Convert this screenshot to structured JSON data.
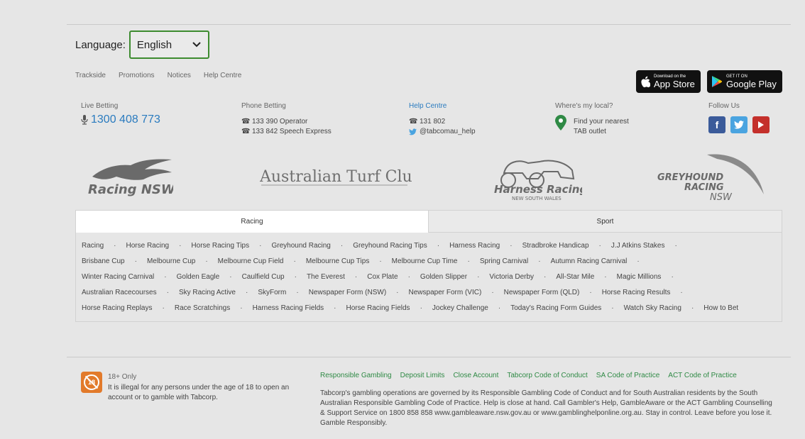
{
  "language": {
    "label": "Language:",
    "selected": "English"
  },
  "quick_links": [
    "Trackside",
    "Promotions",
    "Notices",
    "Help Centre"
  ],
  "app_store": {
    "small": "Download on the",
    "big": "App Store"
  },
  "google_play": {
    "small": "GET IT ON",
    "big": "Google Play"
  },
  "contacts": {
    "live_betting": {
      "title": "Live Betting",
      "number": "1300 408 773"
    },
    "phone_betting": {
      "title": "Phone Betting",
      "line1": "133 390 Operator",
      "line2": "133 842 Speech Express"
    },
    "help_centre": {
      "title": "Help Centre",
      "phone": "131 802",
      "twitter": "@tabcomau_help"
    },
    "local": {
      "title": "Where's my local?",
      "line1": "Find your nearest",
      "line2": "TAB outlet"
    },
    "follow": {
      "title": "Follow Us"
    }
  },
  "logos": {
    "racing_nsw": "Racing NSW",
    "atc": "Australian Turf Club",
    "harness_main": "Harness Racing",
    "harness_sub": "NEW SOUTH WALES",
    "greyhound_1": "GREYHOUND",
    "greyhound_2": "RACING",
    "greyhound_3": "NSW"
  },
  "tabs": {
    "active": "Racing",
    "inactive": "Sport"
  },
  "racing_links": [
    [
      "Racing",
      "Horse Racing",
      "Horse Racing Tips",
      "Greyhound Racing",
      "Greyhound Racing Tips",
      "Harness Racing",
      "Stradbroke Handicap",
      "J.J Atkins Stakes"
    ],
    [
      "Brisbane Cup",
      "Melbourne Cup",
      "Melbourne Cup Field",
      "Melbourne Cup Tips",
      "Melbourne Cup Time",
      "Spring Carnival",
      "Autumn Racing Carnival"
    ],
    [
      "Winter Racing Carnival",
      "Golden Eagle",
      "Caulfield Cup",
      "The Everest",
      "Cox Plate",
      "Golden Slipper",
      "Victoria Derby",
      "All-Star Mile",
      "Magic Millions"
    ],
    [
      "Australian Racecourses",
      "Sky Racing Active",
      "SkyForm",
      "Newspaper Form (NSW)",
      "Newspaper Form (VIC)",
      "Newspaper Form (QLD)",
      "Horse Racing Results"
    ],
    [
      "Horse Racing Replays",
      "Race Scratchings",
      "Harness Racing Fields",
      "Horse Racing Fields",
      "Jockey Challenge",
      "Today's Racing Form Guides",
      "Watch Sky Racing",
      "How to Bet"
    ]
  ],
  "age_notice": {
    "badge": "18",
    "title": "18+ Only",
    "text": "It is illegal for any persons under the age of 18 to open an account or to gamble with Tabcorp."
  },
  "rg_links": [
    "Responsible Gambling",
    "Deposit Limits",
    "Close Account",
    "Tabcorp Code of Conduct",
    "SA Code of Practice",
    "ACT Code of Practice"
  ],
  "rg_text": "Tabcorp's gambling operations are governed by its Responsible Gambling Code of Conduct and for South Australian residents by the South Australian Responsible Gambling Code of Practice. Help is close at hand. Call Gambler's Help, GambleAware or the ACT Gambling Counselling & Support Service on 1800 858 858 www.gambleaware.nsw.gov.au or www.gamblinghelponline.org.au. Stay in control. Leave before you lose it. Gamble Responsibly.",
  "colors": {
    "accent_blue": "#2a7bbf",
    "rg_green": "#2f8a45",
    "select_border": "#3d8b2f",
    "age_orange": "#e27a2b"
  }
}
